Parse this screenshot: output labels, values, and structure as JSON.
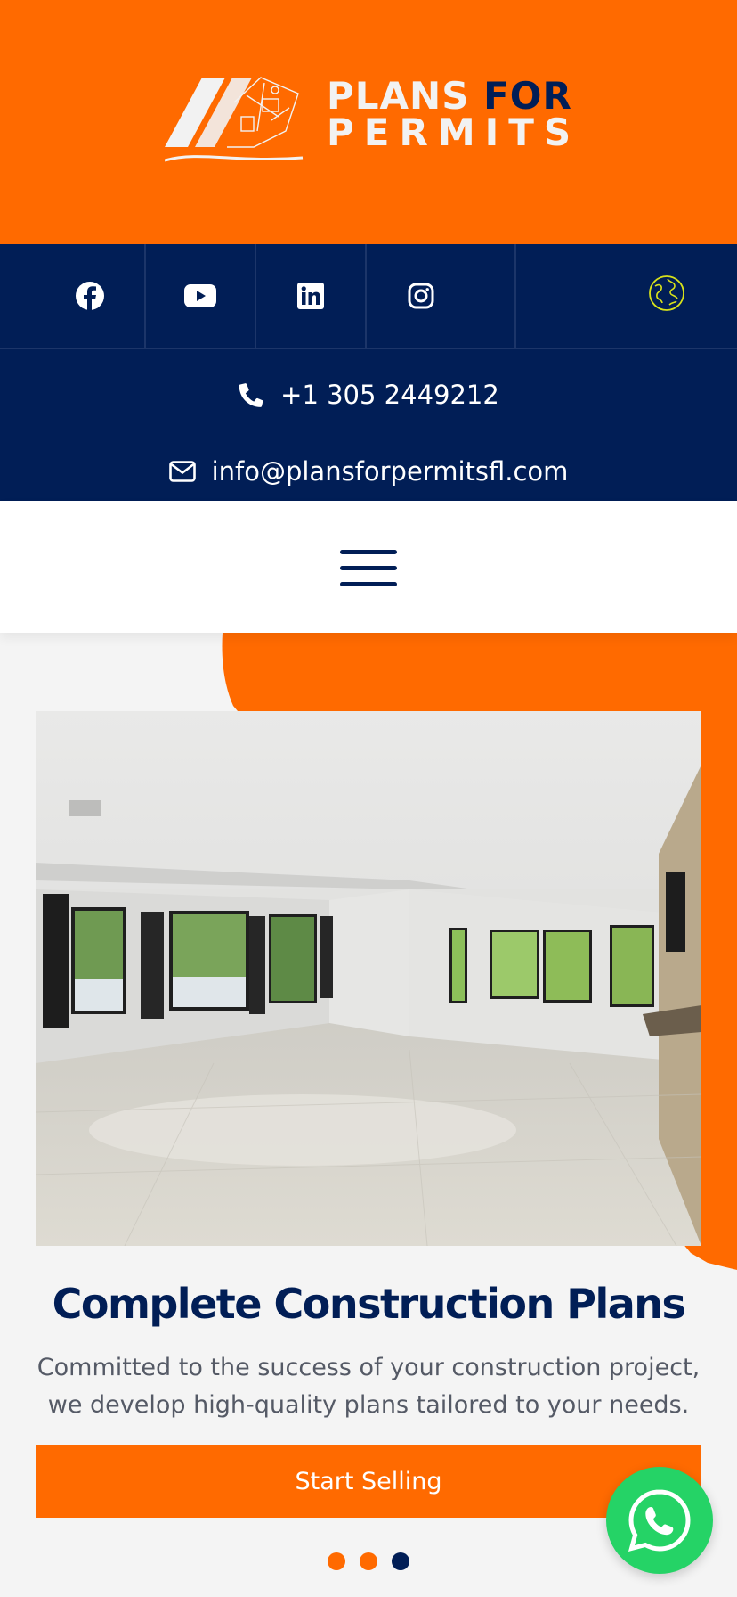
{
  "brand": {
    "line1_a": "PLANS",
    "line1_b": "FOR",
    "line2": "PERMITS",
    "primary_color": "#ff6a00",
    "navy_color": "#011e56"
  },
  "social": [
    {
      "name": "facebook",
      "icon": "facebook-icon"
    },
    {
      "name": "youtube",
      "icon": "youtube-icon"
    },
    {
      "name": "linkedin",
      "icon": "linkedin-icon"
    },
    {
      "name": "instagram",
      "icon": "instagram-icon"
    },
    {
      "name": "language",
      "icon": "globe-icon",
      "color": "#d8e21a"
    }
  ],
  "contact": {
    "phone": "+1 305 2449212",
    "email": "info@plansforpermitsfl.com"
  },
  "nav": {
    "menu_icon": "hamburger-menu-icon"
  },
  "hero": {
    "title": "Complete Construction Plans",
    "description": "Committed to the success of your construction project, we develop high-quality plans tailored to your needs.",
    "cta_label": "Start Selling",
    "slides": [
      {
        "active": false,
        "color": "#ff6a00"
      },
      {
        "active": false,
        "color": "#ff6a00"
      },
      {
        "active": true,
        "color": "#011e56"
      }
    ]
  },
  "whatsapp": {
    "icon": "whatsapp-icon",
    "color": "#25d366"
  }
}
